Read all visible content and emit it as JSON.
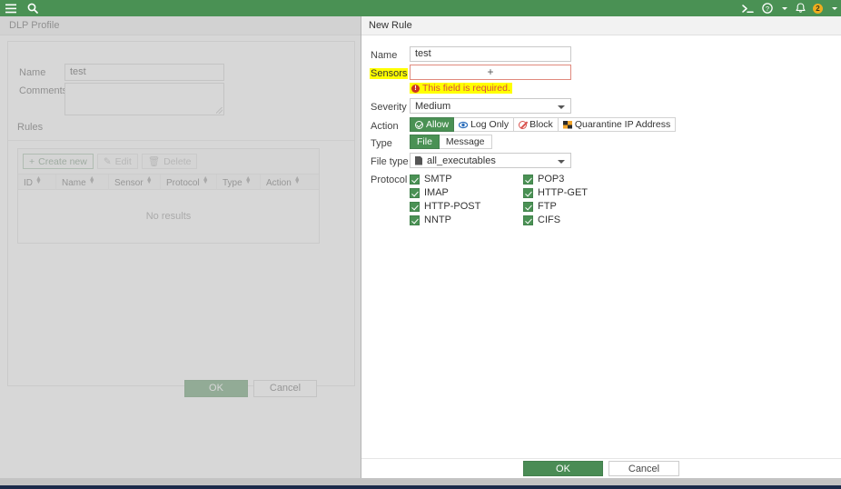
{
  "topbar": {
    "menu_icon": "hamburger-menu-icon",
    "search_icon": "search-icon",
    "terminal_icon": "terminal-icon",
    "help_icon": "help-circle-icon",
    "bell_icon": "bell-icon",
    "notification_count": "2",
    "accent_green": "#4a9154"
  },
  "breadcrumb": {
    "title": "DLP Profile"
  },
  "left_panel": {
    "name_label": "Name",
    "name_value": "test",
    "comments_label": "Comments",
    "comments_value": "",
    "rules_label": "Rules",
    "toolbar": {
      "create_new": "Create new",
      "edit": "Edit",
      "delete": "Delete"
    },
    "table": {
      "columns": [
        "ID",
        "Name",
        "Sensor",
        "Protocol",
        "Type",
        "Action"
      ],
      "empty_message": "No results"
    },
    "ok_label": "OK",
    "cancel_label": "Cancel"
  },
  "modal": {
    "title": "New Rule",
    "name_label": "Name",
    "name_value": "test",
    "sensors_label": "Sensors",
    "sensors_value": "",
    "sensors_add_glyph": "+",
    "sensors_error": "This field is required.",
    "error_icon_glyph": "!",
    "severity_label": "Severity",
    "severity_value": "Medium",
    "action_label": "Action",
    "actions": [
      {
        "label": "Allow",
        "icon": "check-circle-icon",
        "active": true
      },
      {
        "label": "Log Only",
        "icon": "eye-icon",
        "active": false
      },
      {
        "label": "Block",
        "icon": "ban-icon",
        "active": false
      },
      {
        "label": "Quarantine IP Address",
        "icon": "quarantine-icon",
        "active": false
      }
    ],
    "type_label": "Type",
    "types": [
      {
        "label": "File",
        "active": true
      },
      {
        "label": "Message",
        "active": false
      }
    ],
    "file_type_label": "File type",
    "file_type_value": "all_executables",
    "file_type_icon": "file-icon",
    "protocol_label": "Protocol",
    "protocols_col1": [
      {
        "label": "SMTP",
        "checked": true
      },
      {
        "label": "IMAP",
        "checked": true
      },
      {
        "label": "HTTP-POST",
        "checked": true
      },
      {
        "label": "NNTP",
        "checked": true
      }
    ],
    "protocols_col2": [
      {
        "label": "POP3",
        "checked": true
      },
      {
        "label": "HTTP-GET",
        "checked": true
      },
      {
        "label": "FTP",
        "checked": true
      },
      {
        "label": "CIFS",
        "checked": true
      }
    ],
    "ok_label": "OK",
    "cancel_label": "Cancel",
    "highlight_color": "#ffff00",
    "error_color": "#d94c3d"
  }
}
